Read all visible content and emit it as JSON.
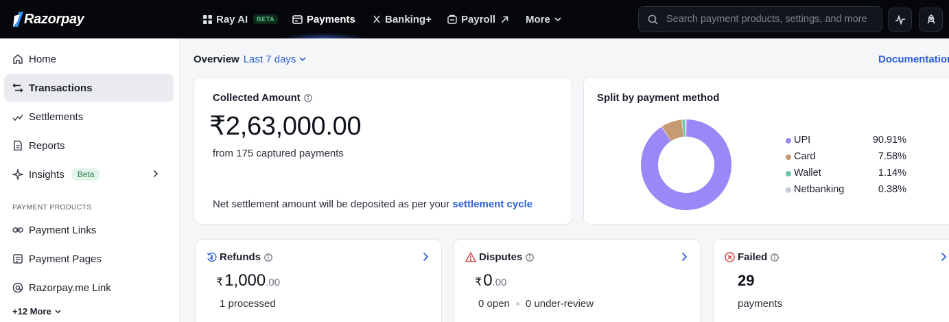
{
  "brand": {
    "name": "Razorpay"
  },
  "topnav": {
    "items": [
      {
        "label": "Ray AI",
        "badge": "BETA"
      },
      {
        "label": "Payments"
      },
      {
        "label": "Banking+"
      },
      {
        "label": "Payroll"
      },
      {
        "label": "More"
      }
    ],
    "search_placeholder": "Search payment products, settings, and more"
  },
  "sidebar": {
    "items": [
      {
        "label": "Home",
        "icon": "home-icon"
      },
      {
        "label": "Transactions",
        "icon": "transactions-icon",
        "active": true
      },
      {
        "label": "Settlements",
        "icon": "settlements-icon"
      },
      {
        "label": "Reports",
        "icon": "reports-icon"
      },
      {
        "label": "Insights",
        "icon": "sparkle-icon",
        "badge": "Beta"
      }
    ],
    "section_title": "PAYMENT PRODUCTS",
    "products": [
      {
        "label": "Payment Links",
        "icon": "link-icon"
      },
      {
        "label": "Payment Pages",
        "icon": "page-icon"
      },
      {
        "label": "Razorpay.me Link",
        "icon": "at-icon"
      }
    ],
    "more_label": "+12 More"
  },
  "overview": {
    "label": "Overview",
    "range": "Last 7 days",
    "documentation": "Documentation"
  },
  "collected": {
    "title": "Collected Amount",
    "amount": "₹2,63,000.00",
    "subtitle": "from 175 captured payments",
    "note": "Net settlement amount will be deposited as per your",
    "note_link": "settlement cycle"
  },
  "split": {
    "title": "Split by payment method"
  },
  "chart_data": {
    "type": "pie",
    "title": "Split by payment method",
    "categories": [
      "UPI",
      "Card",
      "Wallet",
      "Netbanking"
    ],
    "values": [
      90.91,
      7.58,
      1.14,
      0.38
    ],
    "labels": [
      "90.91%",
      "7.58%",
      "1.14%",
      "0.38%"
    ],
    "colors": [
      "#9b87f5",
      "#c79a72",
      "#6cc5ab",
      "#c5ccd6"
    ],
    "donut": true,
    "legend": "right"
  },
  "refunds": {
    "title": "Refunds",
    "currency": "₹",
    "amount_whole": "1,000",
    "amount_decimal": ".00",
    "subtitle": "1 processed"
  },
  "disputes": {
    "title": "Disputes",
    "currency": "₹",
    "amount_whole": "0",
    "amount_decimal": ".00",
    "open": "0 open",
    "review": "0 under-review"
  },
  "failed": {
    "title": "Failed",
    "count": "29",
    "subtitle": "payments"
  }
}
